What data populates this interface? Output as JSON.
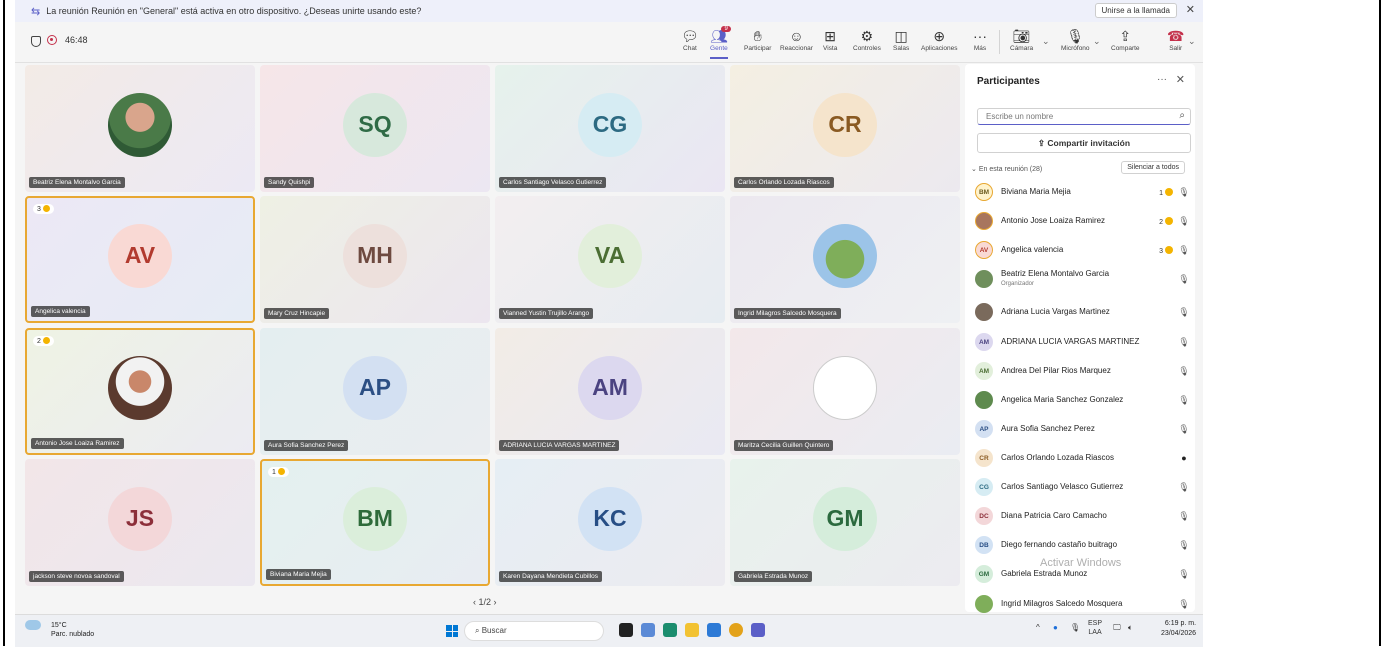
{
  "notification": {
    "text": "La reunión Reunión en \"General\" está activa en otro dispositivo. ¿Deseas unirte usando este?",
    "join_label": "Unirse a la llamada",
    "close_glyph": "✕"
  },
  "meeting": {
    "timer": "46:48"
  },
  "toolbar": {
    "chat": "Chat",
    "people": "Gente",
    "people_badge": "9",
    "raise": "Participar",
    "react": "Reaccionar",
    "view": "Vista",
    "controls": "Controles",
    "rooms": "Salas",
    "apps": "Aplicaciones",
    "more": "Más",
    "camera": "Cámara",
    "mic": "Micrófono",
    "share": "Comparte",
    "leave": "Salir"
  },
  "tiles": [
    {
      "name": "Beatriz Elena Montalvo Garcia",
      "initials": "",
      "hand": ""
    },
    {
      "name": "Sandy Quishpi",
      "initials": "SQ",
      "hand": ""
    },
    {
      "name": "Carlos Santiago Velasco Gutierrez",
      "initials": "CG",
      "hand": ""
    },
    {
      "name": "Carlos Orlando Lozada Riascos",
      "initials": "CR",
      "hand": ""
    },
    {
      "name": "Angelica valencia",
      "initials": "AV",
      "hand": "3"
    },
    {
      "name": "Mary Cruz Hincapie",
      "initials": "MH",
      "hand": ""
    },
    {
      "name": "Vianned Yustin Trujillo Arango",
      "initials": "VA",
      "hand": ""
    },
    {
      "name": "Ingrid Milagros Salcedo Mosquera",
      "initials": "",
      "hand": ""
    },
    {
      "name": "Antonio Jose Loaiza Ramirez",
      "initials": "",
      "hand": "2"
    },
    {
      "name": "Aura Sofia Sanchez Perez",
      "initials": "AP",
      "hand": ""
    },
    {
      "name": "ADRIANA LUCIA VARGAS MARTINEZ",
      "initials": "AM",
      "hand": ""
    },
    {
      "name": "Maritza Cecilia Guillen Quintero",
      "initials": "",
      "hand": ""
    },
    {
      "name": "jackson steve novoa sandoval",
      "initials": "JS",
      "hand": ""
    },
    {
      "name": "Biviana Maria Mejia",
      "initials": "BM",
      "hand": "1"
    },
    {
      "name": "Karen Dayana Mendieta Cubillos",
      "initials": "KC",
      "hand": ""
    },
    {
      "name": "Gabriela Estrada Munoz",
      "initials": "GM",
      "hand": ""
    }
  ],
  "pager": "1/2",
  "panel": {
    "title": "Participantes",
    "search_placeholder": "Escribe un nombre",
    "share_invite": "Compartir invitación",
    "section": "En esta reunión (28)",
    "mute_all": "Silenciar a todos",
    "people": [
      {
        "initials": "BM",
        "name": "Biviana Maria Mejia",
        "sub": "",
        "hand": "1"
      },
      {
        "initials": "",
        "name": "Antonio Jose Loaiza Ramirez",
        "sub": "",
        "hand": "2"
      },
      {
        "initials": "AV",
        "name": "Angelica valencia",
        "sub": "",
        "hand": "3"
      },
      {
        "initials": "",
        "name": "Beatriz Elena Montalvo Garcia",
        "sub": "Organizador",
        "hand": ""
      },
      {
        "initials": "",
        "name": "Adriana Lucia Vargas Martinez",
        "sub": "",
        "hand": ""
      },
      {
        "initials": "AM",
        "name": "ADRIANA LUCIA VARGAS MARTINEZ",
        "sub": "",
        "hand": ""
      },
      {
        "initials": "AM",
        "name": "Andrea Del Pilar Rios Marquez",
        "sub": "",
        "hand": ""
      },
      {
        "initials": "",
        "name": "Angelica Maria Sanchez Gonzalez",
        "sub": "",
        "hand": ""
      },
      {
        "initials": "AP",
        "name": "Aura Sofia Sanchez Perez",
        "sub": "",
        "hand": ""
      },
      {
        "initials": "CR",
        "name": "Carlos Orlando Lozada Riascos",
        "sub": "",
        "hand": ""
      },
      {
        "initials": "CG",
        "name": "Carlos Santiago Velasco Gutierrez",
        "sub": "",
        "hand": ""
      },
      {
        "initials": "DC",
        "name": "Diana Patricia Caro Camacho",
        "sub": "",
        "hand": ""
      },
      {
        "initials": "DB",
        "name": "Diego fernando castaño buitrago",
        "sub": "",
        "hand": ""
      },
      {
        "initials": "GM",
        "name": "Gabriela Estrada Munoz",
        "sub": "",
        "hand": ""
      },
      {
        "initials": "",
        "name": "Ingrid Milagros Salcedo Mosquera",
        "sub": "",
        "hand": ""
      }
    ]
  },
  "watermark": "Activar Windows",
  "taskbar": {
    "temp": "15°C",
    "weather": "Parc. nublado",
    "search": "Buscar",
    "lang1": "ESP",
    "lang2": "LAA",
    "time": "6:19 p. m.",
    "date": "23/04/2026"
  }
}
